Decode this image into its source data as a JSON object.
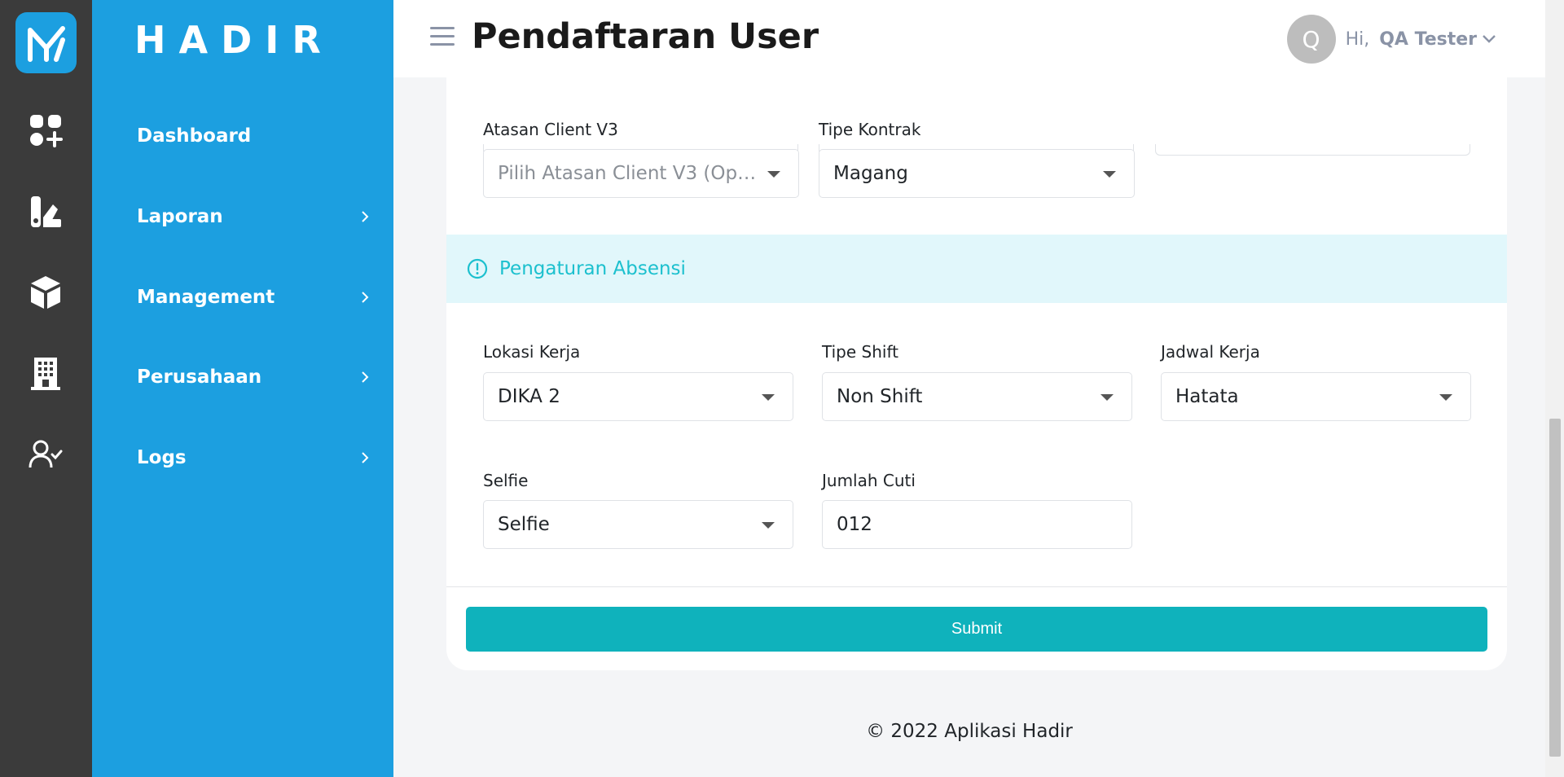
{
  "app": {
    "brand": "HADIR"
  },
  "colors": {
    "sidebar": "#1c9fe0",
    "rail": "#3b3b3b",
    "accent": "#0fb2bc",
    "section_bg": "#e1f7fb",
    "section_text": "#1cc0ce"
  },
  "rail_icons": [
    "logo-icon",
    "dashboard-apps-icon",
    "report-icon",
    "box-icon",
    "building-icon",
    "user-check-icon"
  ],
  "sidebar": {
    "items": [
      {
        "label": "Dashboard",
        "has_children": false
      },
      {
        "label": "Laporan",
        "has_children": true
      },
      {
        "label": "Management",
        "has_children": true
      },
      {
        "label": "Perusahaan",
        "has_children": true
      },
      {
        "label": "Logs",
        "has_children": true
      }
    ]
  },
  "header": {
    "title": "Pendaftaran User",
    "greeting": "Hi,",
    "user_name": "QA Tester",
    "avatar_initial": "Q"
  },
  "form": {
    "atasan_client": {
      "label": "Atasan Client V3",
      "placeholder": "Pilih Atasan Client V3 (Opt..."
    },
    "tipe_kontrak": {
      "label": "Tipe Kontrak",
      "value": "Magang"
    },
    "section_title": "Pengaturan Absensi",
    "lokasi_kerja": {
      "label": "Lokasi Kerja",
      "value": "DIKA 2"
    },
    "tipe_shift": {
      "label": "Tipe Shift",
      "value": "Non Shift"
    },
    "jadwal_kerja": {
      "label": "Jadwal Kerja",
      "value": "Hatata"
    },
    "selfie": {
      "label": "Selfie",
      "value": "Selfie"
    },
    "jumlah_cuti": {
      "label": "Jumlah Cuti",
      "value": "012"
    },
    "submit_label": "Submit"
  },
  "footer": {
    "text": "© 2022 Aplikasi Hadir"
  }
}
